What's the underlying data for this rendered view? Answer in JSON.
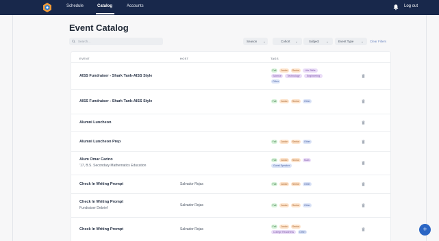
{
  "nav": {
    "schedule": "Schedule",
    "catalog": "Catalog",
    "accounts": "Accounts",
    "logout": "Log out"
  },
  "page": {
    "title": "Event Catalog"
  },
  "search": {
    "placeholder": "Search..."
  },
  "filters": {
    "season": "Season",
    "cohort": "Cohort",
    "subject": "Subject",
    "event_type": "Event Type",
    "clear": "Clear Filters"
  },
  "table": {
    "col_event": "EVENT",
    "col_host": "HOST",
    "col_tags": "TAGS"
  },
  "rows": [
    {
      "name": "AISS Fundraiser - Shark Tank-AISS Style",
      "sub": "",
      "host": "",
      "tags": [
        [
          "Fall",
          "Junior",
          "Senior",
          "Life Skills"
        ],
        [
          "Science",
          "Technology",
          "Engineering"
        ],
        [
          "Other"
        ]
      ]
    },
    {
      "name": "AISS Fundraiser - Shark Tank-AISS Style",
      "sub": "",
      "host": "",
      "tags": [
        [
          "Fall",
          "Junior",
          "Senior",
          "Other"
        ]
      ]
    },
    {
      "name": "Alumni Luncheon",
      "sub": "",
      "host": "",
      "tags": []
    },
    {
      "name": "Alumni Luncheon Prep",
      "sub": "",
      "host": "",
      "tags": [
        [
          "Fall",
          "Junior",
          "Senior",
          "Other"
        ]
      ]
    },
    {
      "name": "Alum Omar Carino",
      "sub": "'17, B.S. Secondary Mathematics Education",
      "host": "",
      "tags": [
        [
          "Fall",
          "Junior",
          "Senior",
          "Math"
        ],
        [
          "Guest Speaker"
        ]
      ]
    },
    {
      "name": "Check In Writing Prompt",
      "sub": "",
      "host": "Salvador Rojas",
      "tags": [
        [
          "Fall",
          "Junior",
          "Senior",
          "Other"
        ]
      ]
    },
    {
      "name": "Check In Writing Prompt",
      "sub": "Fundraiser Debrief",
      "host": "Salvador Rojas",
      "tags": [
        [
          "Fall",
          "Junior",
          "Senior",
          "Other"
        ]
      ]
    },
    {
      "name": "Check In Writing Prompt",
      "sub": "",
      "host": "Salvador Rojas",
      "tags": [
        [
          "Fall",
          "Junior",
          "Senior"
        ],
        [
          "College Readiness",
          "Other"
        ]
      ]
    }
  ],
  "tag_colors": {
    "Fall": "green",
    "Junior": "orange",
    "Senior": "orange",
    "Life Skills": "purple",
    "Science": "purple",
    "Technology": "purple",
    "Engineering": "purple",
    "Math": "purple",
    "College Readiness": "purple",
    "Other": "blue",
    "Guest Speaker": "blue"
  },
  "fab": {
    "label": "+"
  }
}
